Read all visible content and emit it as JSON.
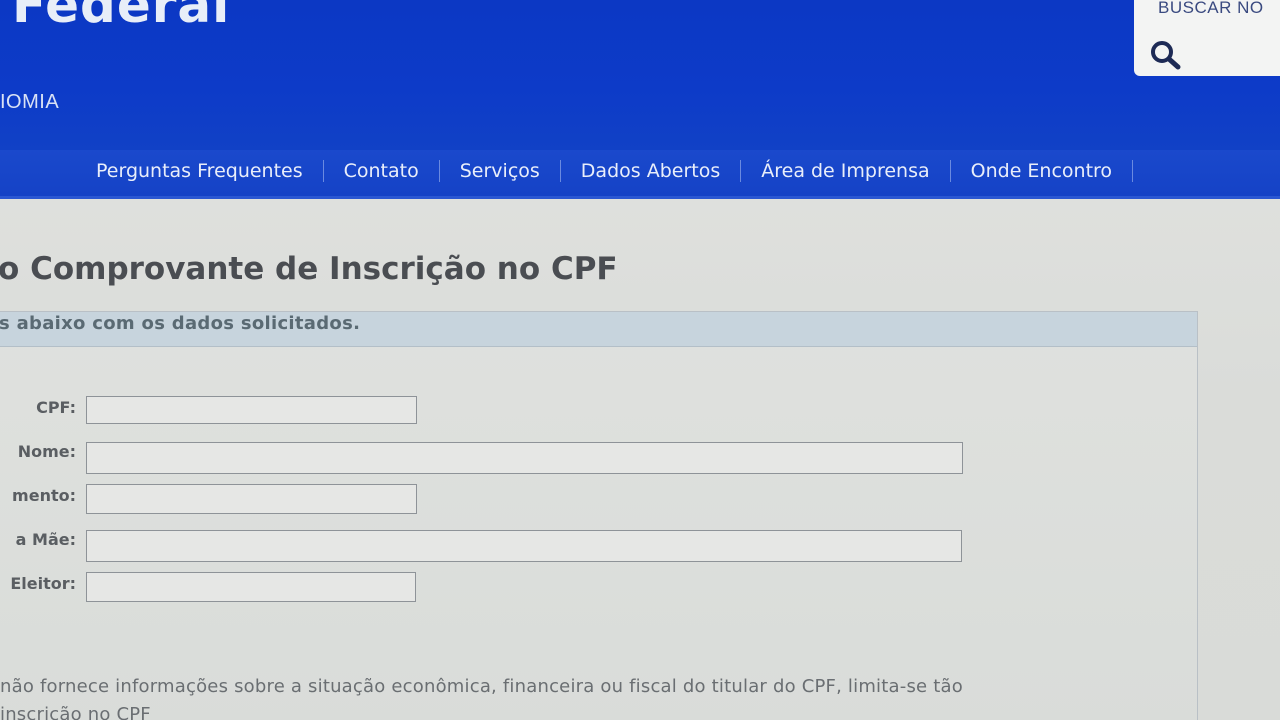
{
  "header": {
    "brand": "Federal",
    "org_line": "IOMIA",
    "search_label": "BUSCAR NO"
  },
  "nav": {
    "items": [
      "Perguntas Frequentes",
      "Contato",
      "Serviços",
      "Dados Abertos",
      "Área de Imprensa",
      "Onde Encontro"
    ]
  },
  "page": {
    "title": "o Comprovante de Inscrição no CPF"
  },
  "form": {
    "instruction": "s abaixo com os dados solicitados.",
    "fields": {
      "cpf": {
        "label": "CPF:",
        "value": ""
      },
      "nome": {
        "label": "Nome:",
        "value": ""
      },
      "nascimento": {
        "label": "mento:",
        "value": ""
      },
      "mae": {
        "label": "a Mãe:",
        "value": ""
      },
      "eleitor": {
        "label": "Eleitor:",
        "value": ""
      }
    }
  },
  "note": {
    "line1": "não fornece informações sobre a situação econômica, financeira ou fiscal do titular do CPF, limita-se tão",
    "line2": "inscrição no CPF"
  },
  "colors": {
    "header_blue": "#0d3bc8",
    "nav_blue": "#1542c6",
    "form_header_bg": "#c7d4dd"
  }
}
